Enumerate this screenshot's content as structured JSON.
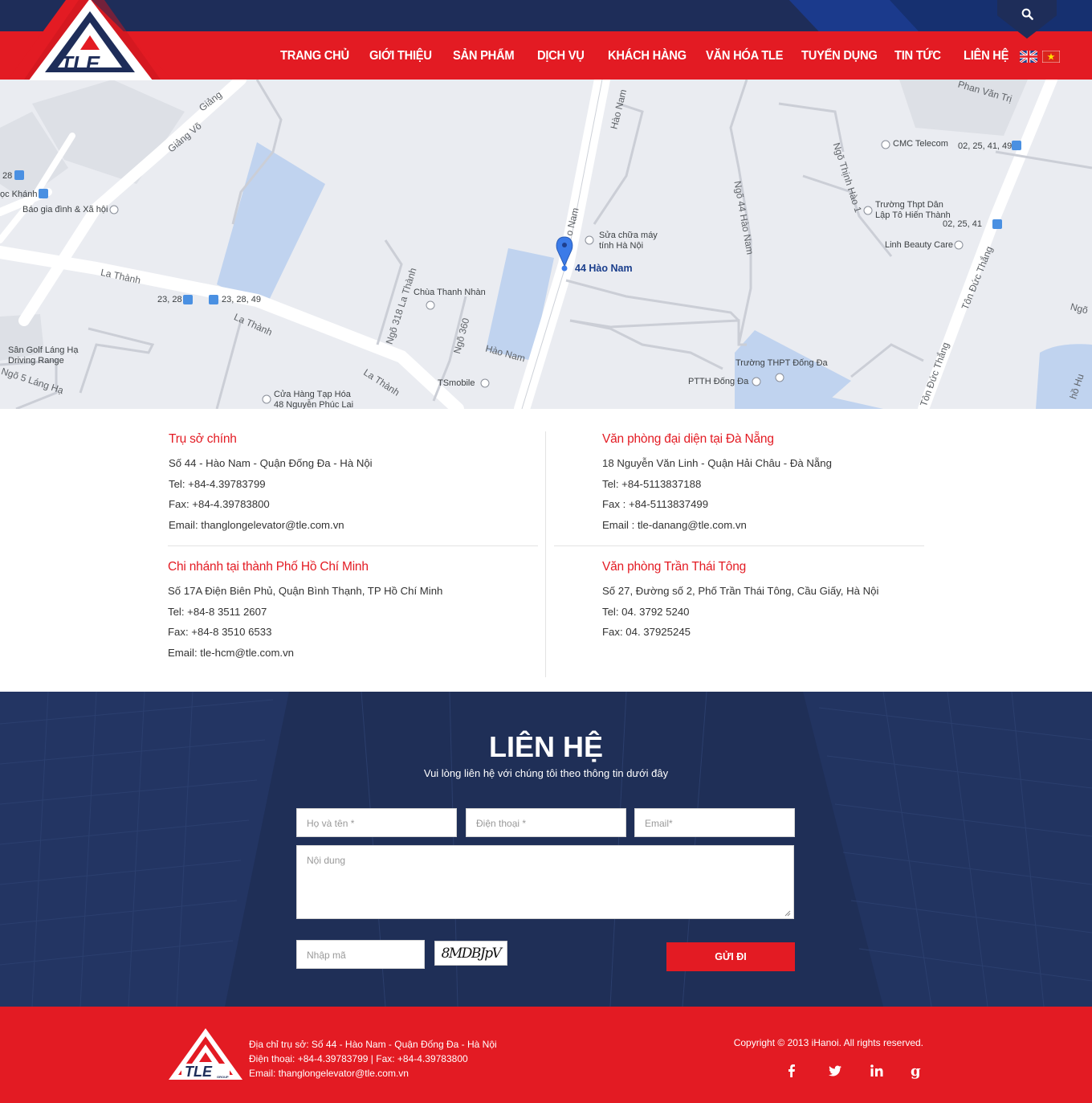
{
  "header": {
    "logo_text": "TLE",
    "logo_sub": "GROUP",
    "nav": [
      {
        "label": "TRANG CHỦ"
      },
      {
        "label": "GIỚI THIỆU"
      },
      {
        "label": "SẢN PHẨM"
      },
      {
        "label": "DỊCH VỤ"
      },
      {
        "label": "KHÁCH HÀNG"
      },
      {
        "label": "VĂN HÓA TLE"
      },
      {
        "label": "TUYỂN DỤNG"
      },
      {
        "label": "TIN TỨC"
      },
      {
        "label": "LIÊN HỆ"
      }
    ],
    "languages": [
      "english-flag-icon",
      "vietnam-flag-icon"
    ],
    "search_icon": "search-icon"
  },
  "map": {
    "pin_label": "44 Hào Nam",
    "labels": {
      "giang_vo_1": "Giảng",
      "giang_vo_2": "Giảng Võ",
      "bao_gia_dinh": "Báo gia đình & Xã hội",
      "ngoc_khanh": "ọc Khánh",
      "bus_28": "28",
      "la_thanh_1": "La Thành",
      "la_thanh_2": "La Thành",
      "la_thanh_3": "La Thành",
      "bus_23_28": "23, 28",
      "bus_23_28_49": "23, 28, 49",
      "san_golf": "Sân Golf Láng Hạ",
      "driving_range": "Driving Range",
      "ngo5_lang_ha": "Ngõ 5 Láng Hạ",
      "cua_hang": "Cửa Hàng Tạp Hóa",
      "cua_hang_2": "48 Nguyễn Phúc Lai",
      "chua_thanh_nhan": "Chùa Thanh Nhàn",
      "ngo_318": "Ngõ 318 La Thành",
      "ngo_360": "Ngõ 360",
      "hao_nam_1": "Hào Nam",
      "hao_nam_2": "Hào Nam",
      "hao_nam_3": "o Nam",
      "tsmobile": "TSmobile",
      "sua_chua_1": "Sửa chữa máy",
      "sua_chua_2": "tính Hà Nội",
      "ngo_44": "Ngõ 44 Hào Nam",
      "cmc": "CMC Telecom",
      "bus_02_1": "02, 25, 41, 49",
      "bus_02_2": "02, 25, 41",
      "thinh_hao": "Ngõ Thịnh Hào 1",
      "truong_thpt_1": "Trường Thpt Dân",
      "truong_thpt_2": "Lập Tô Hiến Thành",
      "linh_beauty": "Linh Beauty Care",
      "phan_van_tri": "Phan Văn Trị",
      "ton_duc_thang_1": "Tôn Đức Thắng",
      "ton_duc_thang_2": "Tôn Đức Thắng",
      "truong_dong_da": "Trường THPT Đống Đa",
      "ptth_dong_da": "PTTH Đống Đa",
      "ngo_right": "Ngõ",
      "ho_hu": "hồ Hu"
    }
  },
  "offices": [
    {
      "title": "Trụ sở chính",
      "lines": [
        "Số 44 - Hào Nam - Quận Đống Đa - Hà Nội",
        "Tel: +84-4.39783799",
        "Fax: +84-4.39783800",
        "Email: thanglongelevator@tle.com.vn"
      ]
    },
    {
      "title": "Văn phòng đại diện tại Đà Nẵng",
      "lines": [
        "18 Nguyễn Văn Linh - Quận Hải Châu - Đà Nẵng",
        "Tel: +84-5113837188",
        "Fax : +84-5113837499",
        "Email : tle-danang@tle.com.vn"
      ]
    },
    {
      "title": "Chi nhánh tại thành Phố Hồ Chí Minh",
      "lines": [
        "Số  17A  Điện Biên Phủ, Quận Bình Thạnh, TP Hồ Chí Minh",
        "Tel: +84-8 3511 2607",
        "Fax: +84-8 3510 6533",
        "Email: tle-hcm@tle.com.vn"
      ]
    },
    {
      "title": "Văn phòng Trần Thái Tông",
      "lines": [
        "Số 27, Đường số 2, Phố Trần Thái Tông, Cầu Giấy, Hà Nội",
        "Tel: 04. 3792 5240",
        "Fax: 04. 37925245"
      ]
    }
  ],
  "contact": {
    "title": "LIÊN HỆ",
    "subtitle": "Vui lòng liên hệ với chúng tôi theo thông tin dưới đây",
    "name_placeholder": "Họ và tên *",
    "phone_placeholder": "Điện thoại *",
    "email_placeholder": "Email*",
    "message_placeholder": "Nội dung",
    "captcha_placeholder": "Nhập mã",
    "captcha_text": "8MDBJpV",
    "send_label": "GỬI ĐI"
  },
  "footer": {
    "address": "Địa chỉ trụ sở: Số 44 - Hào Nam - Quận Đống Đa - Hà Nội",
    "phone": "Điện thoại:  +84-4.39783799  |  Fax: +84-4.39783800",
    "email": "Email: thanglongelevator@tle.com.vn",
    "copyright": "Copyright © 2013 iHanoi. All rights reserved.",
    "social": [
      "facebook-icon",
      "twitter-icon",
      "linkedin-icon",
      "google-plus-icon"
    ]
  }
}
